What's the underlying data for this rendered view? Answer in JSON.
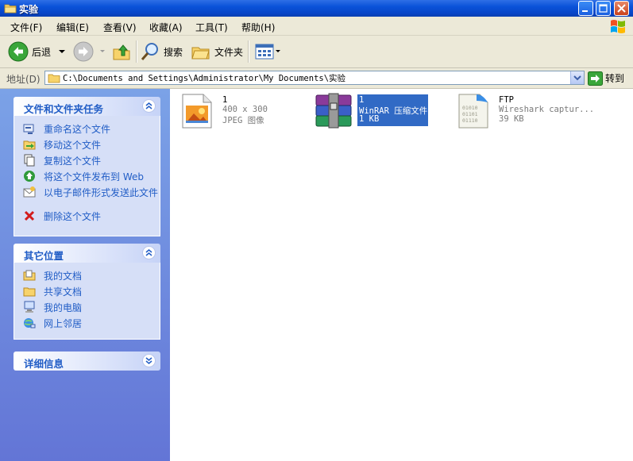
{
  "window": {
    "title": "实验"
  },
  "menu": [
    {
      "label": "文件(F)"
    },
    {
      "label": "编辑(E)"
    },
    {
      "label": "查看(V)"
    },
    {
      "label": "收藏(A)"
    },
    {
      "label": "工具(T)"
    },
    {
      "label": "帮助(H)"
    }
  ],
  "toolbar": {
    "back_label": "后退",
    "search_label": "搜索",
    "folders_label": "文件夹"
  },
  "address": {
    "label": "地址(D)",
    "path": "C:\\Documents and Settings\\Administrator\\My Documents\\实验",
    "go_label": "转到"
  },
  "sidebar": {
    "tasks_panel": {
      "title": "文件和文件夹任务",
      "items": [
        {
          "label": "重命名这个文件",
          "icon": "rename-icon"
        },
        {
          "label": "移动这个文件",
          "icon": "move-icon"
        },
        {
          "label": "复制这个文件",
          "icon": "copy-icon"
        },
        {
          "label": "将这个文件发布到 Web",
          "icon": "publish-web-icon"
        },
        {
          "label": "以电子邮件形式发送此文件",
          "icon": "email-icon"
        },
        {
          "label": "删除这个文件",
          "icon": "delete-icon"
        }
      ]
    },
    "places_panel": {
      "title": "其它位置",
      "items": [
        {
          "label": "我的文档",
          "icon": "my-documents-icon"
        },
        {
          "label": "共享文档",
          "icon": "shared-documents-icon"
        },
        {
          "label": "我的电脑",
          "icon": "my-computer-icon"
        },
        {
          "label": "网上邻居",
          "icon": "network-places-icon"
        }
      ]
    },
    "details_panel": {
      "title": "详细信息"
    }
  },
  "files": [
    {
      "name": "1",
      "type": "400 x 300",
      "size": "JPEG 图像",
      "icon": "jpeg-image-icon",
      "selected": false
    },
    {
      "name": "1",
      "type": "WinRAR 压缩文件",
      "size": "1 KB",
      "icon": "winrar-archive-icon",
      "selected": true
    },
    {
      "name": "FTP",
      "type": "Wireshark captur...",
      "size": "39 KB",
      "icon": "wireshark-capture-icon",
      "selected": false
    }
  ],
  "colors": {
    "titlebar": "#0a52d8",
    "sidebar_bg": "#6f8ee0",
    "task_text": "#215dc6",
    "selection": "#316ac5"
  }
}
